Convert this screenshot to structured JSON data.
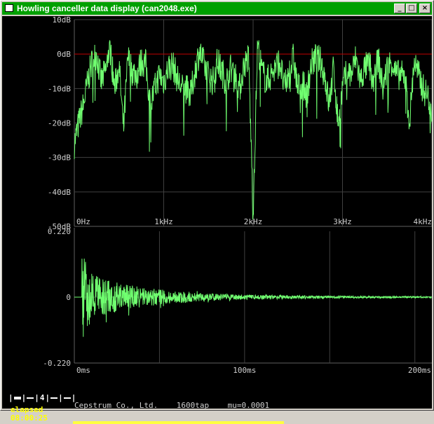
{
  "window": {
    "title": "Howling canceller data display (can2048.exe)",
    "buttons": [
      "_",
      "□",
      "×"
    ]
  },
  "colors": {
    "trace": "#70ff70",
    "grid": "#404040",
    "refline": "#c00000",
    "axis_text": "#d0d0d0"
  },
  "spectrum": {
    "ytick_labels": [
      "10dB",
      "0dB",
      "-10dB",
      "-20dB",
      "-30dB",
      "-40dB",
      "-50dB"
    ],
    "xtick_labels": [
      "0Hz",
      "1kHz",
      "2kHz",
      "3kHz",
      "4kHz"
    ]
  },
  "impulse": {
    "ytick_labels": [
      "0.220",
      "0",
      "-0.220"
    ],
    "xtick_labels": [
      "0ms",
      "100ms",
      "200ms"
    ]
  },
  "status": {
    "company": "Cepstrum Co., Ltd.",
    "taps": "1600tap",
    "mu": "mu=0.0001",
    "elapsed_label": "elapsed",
    "elapsed_time": "08:00:25",
    "selector_value": "4",
    "progress": 0.5
  },
  "chart_data": [
    {
      "type": "line",
      "xlabel": "",
      "ylabel": "",
      "xlim": [
        0,
        4000
      ],
      "ylim": [
        -50,
        10
      ],
      "xticks": [
        "0Hz",
        "1kHz",
        "2kHz",
        "3kHz",
        "4kHz"
      ],
      "yticks": [
        "10dB",
        "0dB",
        "-10dB",
        "-20dB",
        "-30dB",
        "-40dB",
        "-50dB"
      ],
      "reference_line_y": 0,
      "series": [
        {
          "x": [
            0,
            50,
            100,
            150,
            200,
            250,
            300,
            350,
            400,
            450,
            500,
            550,
            600,
            650,
            700,
            750,
            800,
            850,
            900,
            950,
            1000,
            1050,
            1100,
            1150,
            1200,
            1250,
            1300,
            1350,
            1400,
            1450,
            1500,
            1550,
            1600,
            1650,
            1700,
            1750,
            1800,
            1850,
            1900,
            1950,
            2000,
            2050,
            2100,
            2150,
            2200,
            2250,
            2300,
            2350,
            2400,
            2450,
            2500,
            2550,
            2600,
            2650,
            2700,
            2750,
            2800,
            2850,
            2900,
            2950,
            3000,
            3050,
            3100,
            3150,
            3200,
            3250,
            3300,
            3350,
            3400,
            3450,
            3500,
            3550,
            3600,
            3650,
            3700,
            3750,
            3800,
            3850,
            3900,
            3950,
            4000
          ],
          "y": [
            -26,
            -20,
            -15,
            -8,
            -2,
            0,
            -8,
            -5,
            2,
            -10,
            -3,
            -22,
            -1,
            -5,
            -6,
            -2,
            -3,
            -15,
            -10,
            -6,
            -8,
            -4,
            -3,
            -7,
            -10,
            -10,
            -12,
            -5,
            1,
            -3,
            -6,
            -8,
            -2,
            -5,
            -8,
            -4,
            -6,
            -10,
            -3,
            -1,
            -46,
            3,
            -5,
            -8,
            -6,
            -4,
            -2,
            -10,
            -6,
            -1,
            -10,
            -8,
            -12,
            -3,
            -1,
            -2,
            -6,
            -15,
            -4,
            -20,
            -10,
            -5,
            -6,
            -1,
            -8,
            -4,
            -3,
            -8,
            -1,
            -10,
            -4,
            -2,
            -6,
            -6,
            -7,
            -20,
            -2,
            -6,
            -10,
            -12,
            -16
          ]
        }
      ]
    },
    {
      "type": "line",
      "xlabel": "",
      "ylabel": "",
      "xlim": [
        0,
        210
      ],
      "ylim": [
        -0.22,
        0.22
      ],
      "xticks": [
        "0ms",
        "100ms",
        "200ms"
      ],
      "yticks": [
        "0.220",
        "0",
        "-0.220"
      ],
      "series": [
        {
          "envelope_t_ms": [
            0,
            5,
            10,
            20,
            40,
            60,
            80,
            100,
            150,
            210
          ],
          "envelope_amplitude": [
            0.0,
            0.18,
            0.1,
            0.07,
            0.04,
            0.025,
            0.015,
            0.01,
            0.005,
            0.003
          ]
        }
      ]
    }
  ]
}
